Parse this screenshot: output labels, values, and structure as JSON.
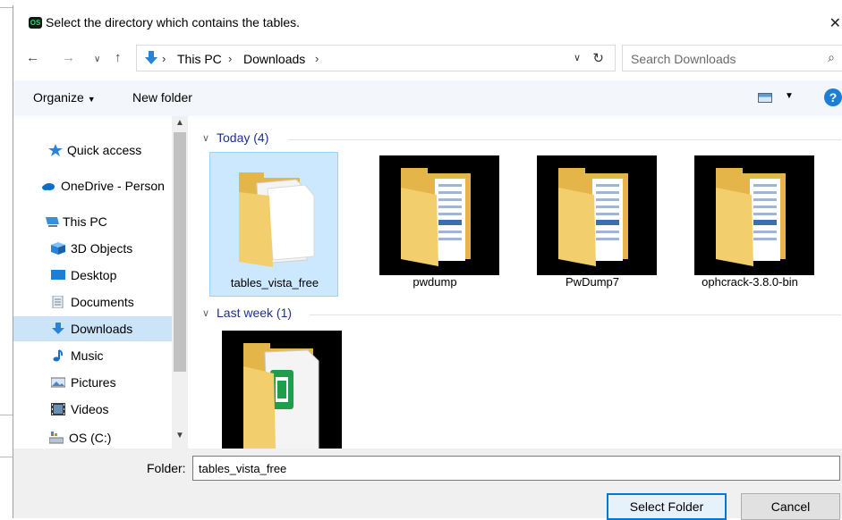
{
  "dialog": {
    "app_icon_text": "OS",
    "title": "Select the directory which contains the tables."
  },
  "address": {
    "crumbs": [
      "This PC",
      "Downloads"
    ],
    "search_placeholder": "Search Downloads"
  },
  "toolbar": {
    "organize_label": "Organize",
    "new_folder_label": "New folder",
    "help_label": "?"
  },
  "nav_pane": {
    "items": [
      {
        "label": "Quick access",
        "icon": "star-icon"
      },
      {
        "label": "OneDrive - Person",
        "icon": "cloud-icon"
      },
      {
        "label": "This PC",
        "icon": "computer-icon"
      },
      {
        "label": "3D Objects",
        "icon": "cube-icon"
      },
      {
        "label": "Desktop",
        "icon": "desktop-icon"
      },
      {
        "label": "Documents",
        "icon": "documents-icon"
      },
      {
        "label": "Downloads",
        "icon": "download-icon",
        "selected": true
      },
      {
        "label": "Music",
        "icon": "music-icon"
      },
      {
        "label": "Pictures",
        "icon": "pictures-icon"
      },
      {
        "label": "Videos",
        "icon": "videos-icon"
      },
      {
        "label": "OS (C:)",
        "icon": "drive-icon"
      }
    ]
  },
  "content": {
    "groups": [
      {
        "label": "Today (4)",
        "items": [
          {
            "name": "tables_vista_free",
            "selected": true
          },
          {
            "name": "pwdump"
          },
          {
            "name": "PwDump7"
          },
          {
            "name": "ophcrack-3.8.0-bin"
          }
        ]
      },
      {
        "label": "Last week (1)",
        "items": [
          {
            "name": ""
          }
        ]
      }
    ]
  },
  "footer": {
    "folder_label": "Folder:",
    "folder_value": "tables_vista_free",
    "select_button": "Select Folder",
    "cancel_button": "Cancel"
  },
  "colors": {
    "selection": "#cce8ff",
    "accent": "#0078d7",
    "group_header": "#1e3287"
  }
}
